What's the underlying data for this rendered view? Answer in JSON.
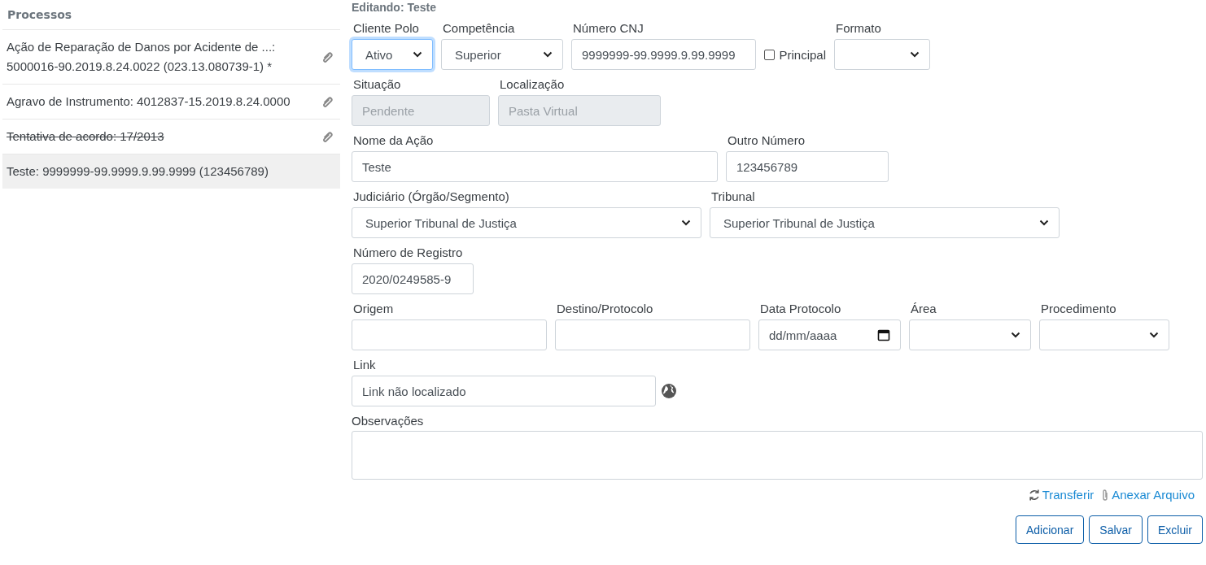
{
  "sidebar": {
    "title": "Processos",
    "items": [
      {
        "text": "Ação de Reparação de Danos por Acidente de ...: 5000016-90.2019.8.24.0022 (023.13.080739-1) *",
        "attachment": true,
        "struck": false,
        "selected": false
      },
      {
        "text": "Agravo de Instrumento: 4012837-15.2019.8.24.0000",
        "attachment": true,
        "struck": false,
        "selected": false
      },
      {
        "text": "Tentativa de acordo: 17/2013",
        "attachment": true,
        "struck": true,
        "selected": false
      },
      {
        "text": "Teste: 9999999-99.9999.9.99.9999 (123456789)",
        "attachment": false,
        "struck": false,
        "selected": true
      }
    ]
  },
  "form": {
    "heading": "Editando: Teste",
    "rows": [
      [
        {
          "kind": "select",
          "label": "Cliente Polo",
          "value": "Ativo",
          "focused": true
        },
        {
          "kind": "select",
          "label": "Competência",
          "value": "Superior",
          "focused": false
        },
        {
          "kind": "text",
          "label": "Número CNJ",
          "value": "9999999-99.9999.9.99.9999",
          "disabled": false,
          "option": {
            "label": "Principal",
            "checked": false
          }
        },
        {
          "kind": "select",
          "label": "Formato",
          "focused": false
        }
      ],
      [
        {
          "kind": "text",
          "label": "Situação",
          "value": "Pendente",
          "disabled": true
        },
        {
          "kind": "text",
          "label": "Localização",
          "value": "Pasta Virtual",
          "disabled": true
        }
      ],
      [
        {
          "kind": "text",
          "label": "Nome da Ação",
          "value": "Teste",
          "disabled": false
        },
        {
          "kind": "text",
          "label": "Outro Número",
          "value": "123456789",
          "disabled": false
        }
      ],
      [
        {
          "kind": "select",
          "label": "Judiciário (Órgão/Segmento)",
          "value": "Superior Tribunal de Justiça",
          "focused": false
        },
        {
          "kind": "select",
          "label": "Tribunal",
          "value": "Superior Tribunal de Justiça",
          "focused": false
        }
      ],
      [
        {
          "kind": "text",
          "label": "Número de Registro",
          "value": "2020/0249585-9",
          "disabled": false
        }
      ],
      [
        {
          "kind": "text",
          "label": "Origem",
          "disabled": false
        },
        {
          "kind": "text",
          "label": "Destino/Protocolo",
          "disabled": false
        },
        {
          "kind": "date",
          "label": "Data Protocolo",
          "value": "dd/mm/aaaa"
        },
        {
          "kind": "select",
          "label": "Área",
          "focused": false
        },
        {
          "kind": "select",
          "label": "Procedimento",
          "focused": false
        }
      ],
      [
        {
          "kind": "link",
          "label": "Link",
          "value": "Link não localizado"
        }
      ]
    ],
    "notes": {
      "label": "Observações"
    },
    "actions": [
      {
        "kind": "transfer",
        "label": "Transferir"
      },
      {
        "kind": "attach",
        "label": "Anexar Arquivo"
      }
    ],
    "buttons": [
      "Adicionar",
      "Salvar",
      "Excluir"
    ]
  }
}
